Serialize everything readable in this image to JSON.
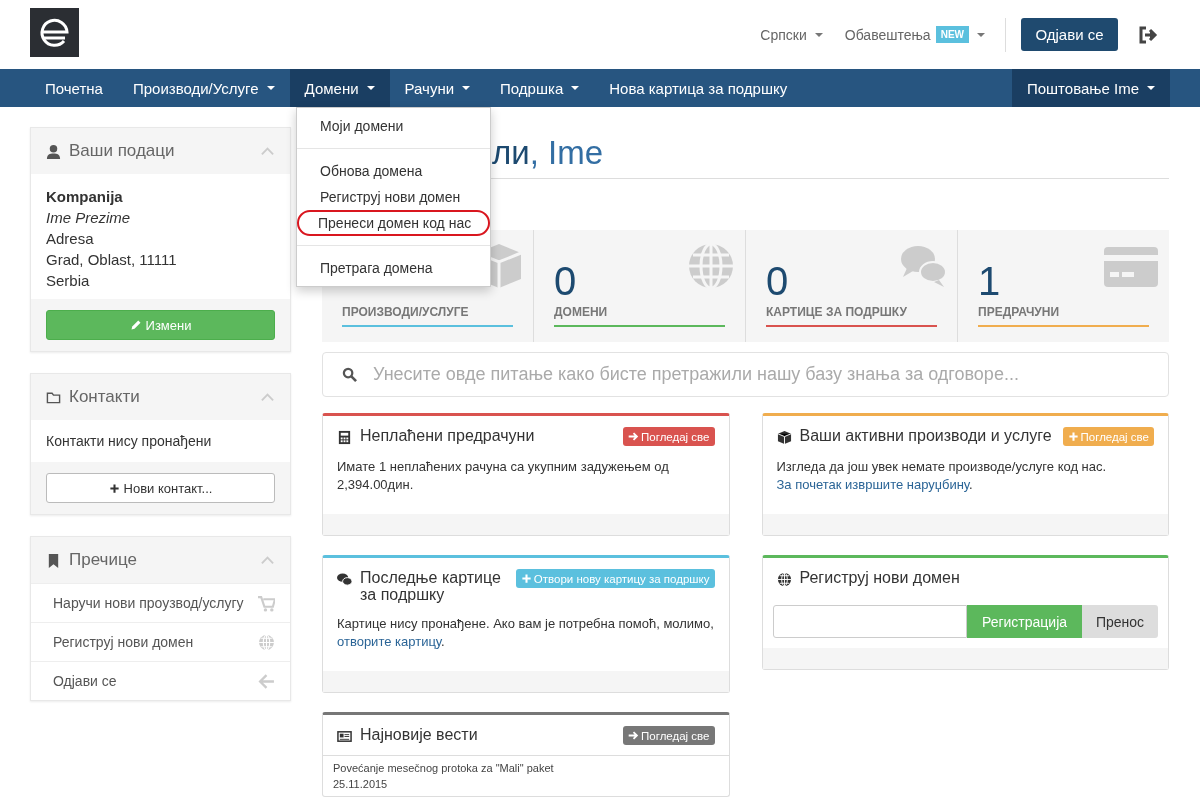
{
  "header": {
    "language": "Српски",
    "notifications": {
      "label": "Обавештења",
      "badge": "NEW"
    },
    "logout_button": "Одјави се"
  },
  "nav": {
    "items": [
      {
        "label": "Почетна",
        "dropdown": false,
        "selected": false
      },
      {
        "label": "Производи/Услуге",
        "dropdown": true,
        "selected": false
      },
      {
        "label": "Домени",
        "dropdown": true,
        "selected": true
      },
      {
        "label": "Рачуни",
        "dropdown": true,
        "selected": false
      },
      {
        "label": "Подршка",
        "dropdown": true,
        "selected": false
      },
      {
        "label": "Нова картица за подршку",
        "dropdown": false,
        "selected": false
      }
    ],
    "user_menu": {
      "label": "Поштовање Ime",
      "dropdown": true
    }
  },
  "dropdown_menu": {
    "groups": [
      [
        {
          "label": "Моји домени",
          "highlighted": false
        }
      ],
      [
        {
          "label": "Обнова домена",
          "highlighted": false
        },
        {
          "label": "Региструј нови домен",
          "highlighted": false
        },
        {
          "label": "Пренеси домен код нас",
          "highlighted": true
        }
      ],
      [
        {
          "label": "Претрага домена",
          "highlighted": false
        }
      ]
    ]
  },
  "sidebar": {
    "panels": [
      {
        "kind": "profile",
        "title": "Ваши подаци",
        "company": "Kompanija",
        "person": "Ime Prezime",
        "lines": [
          "Adresa",
          "Grad, Oblast, 11111",
          "Serbia"
        ],
        "button": "Измени"
      },
      {
        "kind": "contacts",
        "title": "Контакти",
        "message": "Контакти нису пронађени",
        "button": "Нови контакт..."
      },
      {
        "kind": "links",
        "title": "Пречице",
        "items": [
          "Наручи нови проузвод/услугу",
          "Региструј нови домен",
          "Одјави се"
        ]
      }
    ]
  },
  "main": {
    "heading": {
      "text": "ли",
      "name": ", Ime"
    },
    "stats": [
      {
        "label": "ПРОИЗВОДИ/УСЛУГЕ",
        "color": "#5bc0de"
      },
      {
        "value": "0",
        "label": "ДОМЕНИ",
        "color": "#5cb85c"
      },
      {
        "value": "0",
        "label": "КАРТИЦЕ ЗА ПОДРШКУ",
        "color": "#d9534f"
      },
      {
        "value": "1",
        "label": "ПРЕДРАЧУНИ",
        "color": "#f0ad4e"
      }
    ],
    "search": {
      "placeholder": "Унесите овде питање како бисте претражили нашу базу знања за одговоре..."
    },
    "left_panels": [
      {
        "kind": "text",
        "title": "Неплаћени предрачуни",
        "color": "#d9534f",
        "button": {
          "label": "Погледај све",
          "kind": "view"
        },
        "body": {
          "text": "Имате 1 неплаћених рачуна са укупним задужењем од 2,394.00дин."
        }
      },
      {
        "kind": "text",
        "title": "Последње картице за подршку",
        "color": "#5bc0de",
        "button": {
          "label": "Отвори нову картицу за подршку",
          "kind": "add"
        },
        "body": {
          "text": "Картице нису пронађене. Ако вам је потребна помоћ, молимо,",
          "link": "отворите картицу",
          "after": "."
        }
      },
      {
        "kind": "news",
        "title": "Најновије вести",
        "color": "#777777",
        "button": {
          "label": "Погледај све",
          "kind": "view"
        },
        "items": [
          {
            "title": "Povećanje mesečnog protoka za \"Mali\" paket",
            "date": "25.11.2015"
          }
        ]
      }
    ],
    "right_panels": [
      {
        "kind": "text",
        "title": "Ваши активни производи и услуге",
        "color": "#f0ad4e",
        "button": {
          "label": "Погледај све",
          "kind": "add"
        },
        "body": {
          "text": "Изгледа да још увек немате производе/услуге код нас.",
          "link": "За почетак извршите наруџбину",
          "after": "."
        }
      },
      {
        "kind": "domain",
        "title": "Региструј нови домен",
        "color": "#5cb85c",
        "register_button": "Регистрација",
        "transfer_button": "Пренос"
      }
    ]
  }
}
